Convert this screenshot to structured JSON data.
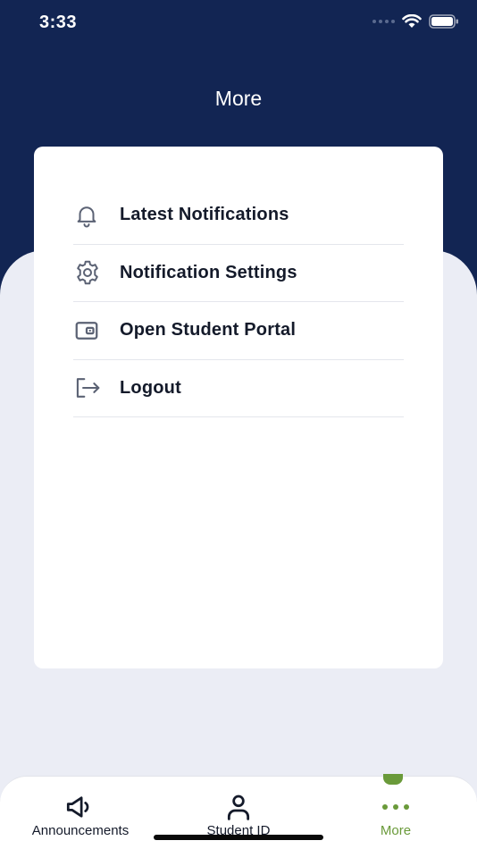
{
  "status_bar": {
    "time": "3:33"
  },
  "header": {
    "title": "More"
  },
  "menu": {
    "items": [
      {
        "label": "Latest Notifications",
        "icon": "bell-icon"
      },
      {
        "label": "Notification Settings",
        "icon": "gear-icon"
      },
      {
        "label": "Open Student Portal",
        "icon": "wallet-icon"
      },
      {
        "label": "Logout",
        "icon": "logout-icon"
      }
    ]
  },
  "tab_bar": {
    "tabs": [
      {
        "label": "Announcements",
        "icon": "megaphone-icon"
      },
      {
        "label": "Student ID",
        "icon": "person-icon"
      },
      {
        "label": "More",
        "icon": "more-dots-icon",
        "active": true
      }
    ]
  },
  "colors": {
    "header_bg": "#122553",
    "page_bg": "#ebedf5",
    "active_tab": "#6a9a3a",
    "text": "#141a2a",
    "icon_gray": "#5b6274"
  }
}
